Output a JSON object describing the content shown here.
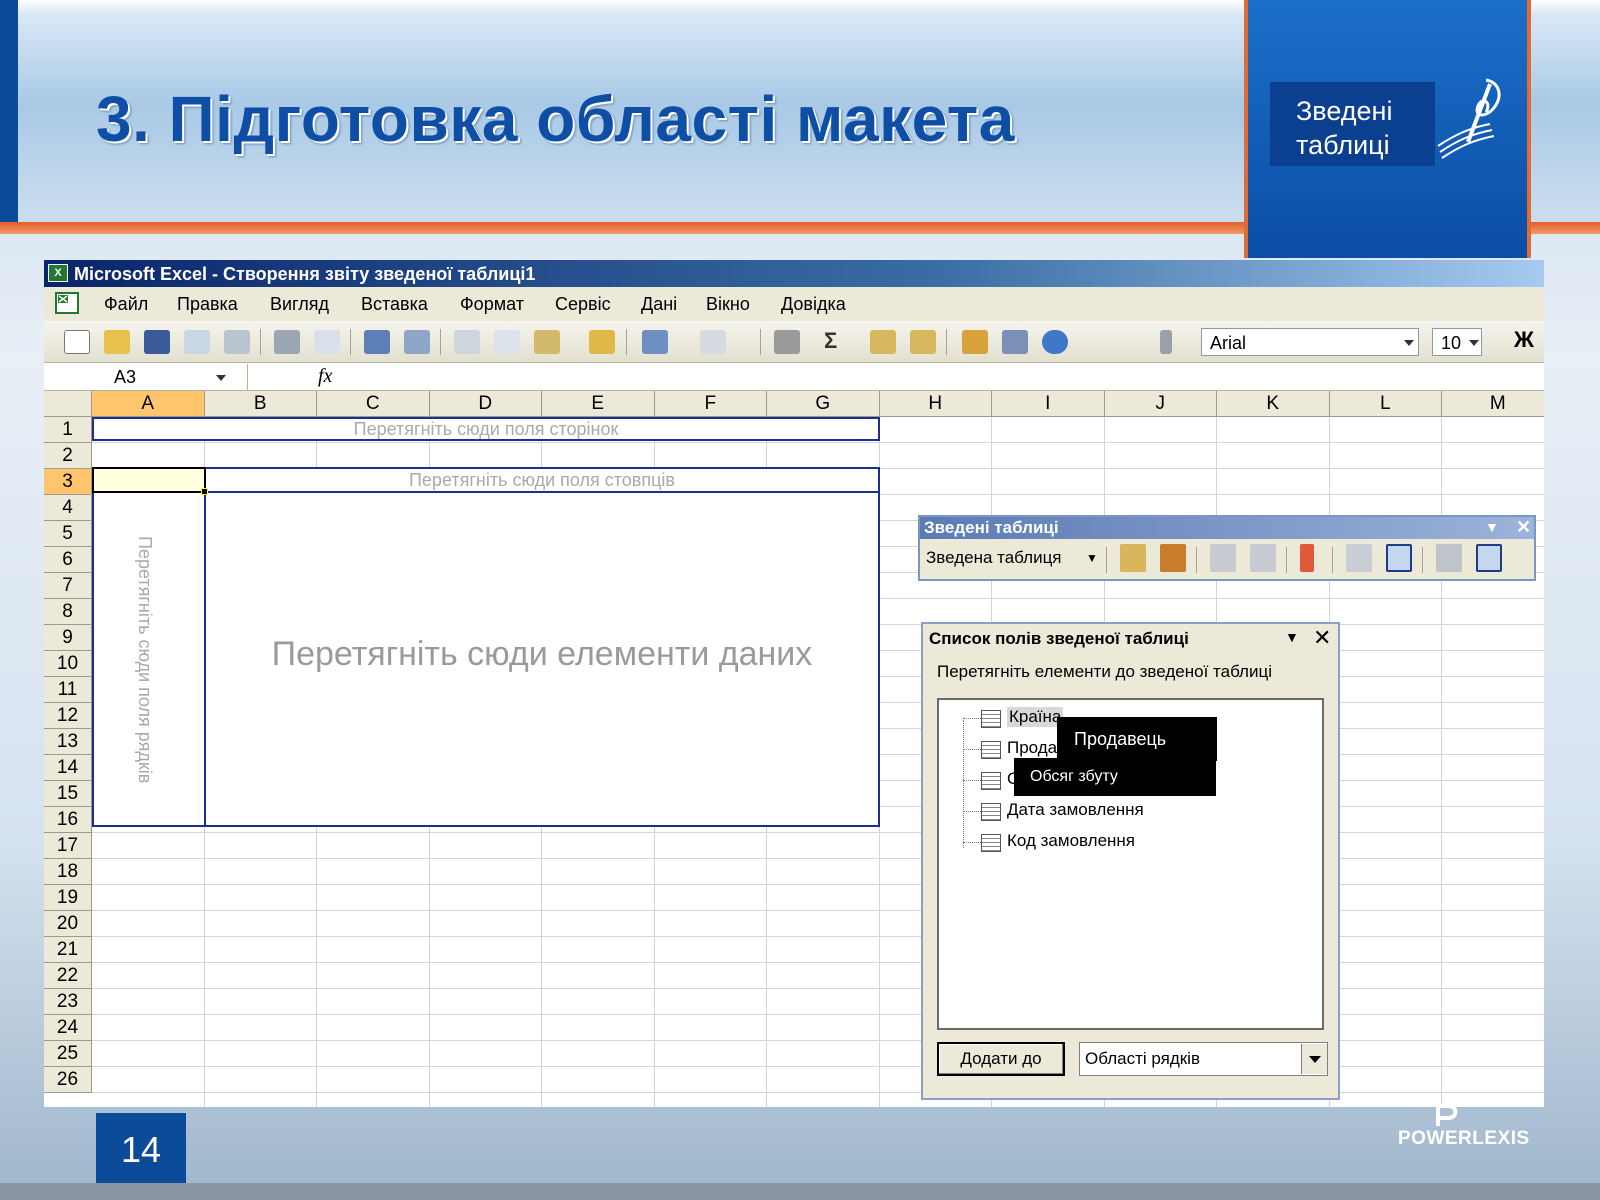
{
  "slide": {
    "title": "3. Підготовка області макета",
    "badge": "Зведені таблиці",
    "page_number": "14",
    "brand": "POWERLEXIS"
  },
  "excel": {
    "window_title": "Microsoft Excel - Створення звіту зведеної таблиці1",
    "menu": [
      "Файл",
      "Правка",
      "Вигляд",
      "Вставка",
      "Формат",
      "Сервіс",
      "Дані",
      "Вікно",
      "Довідка"
    ],
    "toolbar": {
      "sum_symbol": "Σ",
      "font_name": "Arial",
      "font_size": "10",
      "bold_label": "Ж"
    },
    "name_box": "A3",
    "fx_label": "fx",
    "columns": [
      "A",
      "B",
      "C",
      "D",
      "E",
      "F",
      "G",
      "H",
      "I",
      "J",
      "K",
      "L",
      "M"
    ],
    "rows": [
      "1",
      "2",
      "3",
      "4",
      "5",
      "6",
      "7",
      "8",
      "9",
      "10",
      "11",
      "12",
      "13",
      "14",
      "15",
      "16",
      "17",
      "18",
      "19",
      "20",
      "21",
      "22",
      "23",
      "24",
      "25",
      "26"
    ],
    "pivot_layout": {
      "page_fields_hint": "Перетягніть сюди поля сторінок",
      "column_fields_hint": "Перетягніть сюди поля стовпців",
      "row_fields_hint": "Перетягніть сюди поля рядків",
      "data_items_hint": "Перетягніть сюди елементи даних"
    },
    "pivot_toolbar": {
      "caption": "Зведені таблиці",
      "menu_label": "Зведена таблиця",
      "close": "✕"
    },
    "field_list": {
      "caption": "Список полів зведеної таблиці",
      "close": "✕",
      "instruction": "Перетягніть елементи до зведеної таблиці",
      "fields": [
        "Країна",
        "Продавець",
        "Обсяг збуту",
        "Дата замовлення",
        "Код замовлення"
      ],
      "visible_labels": [
        "Країна",
        "Прода",
        "О",
        "Дата замовлення",
        "Код замовлення"
      ],
      "add_button": "Додати до",
      "target_area": "Області рядків"
    },
    "drag_tooltips": [
      "Продавець",
      "Обсяг збуту"
    ]
  }
}
